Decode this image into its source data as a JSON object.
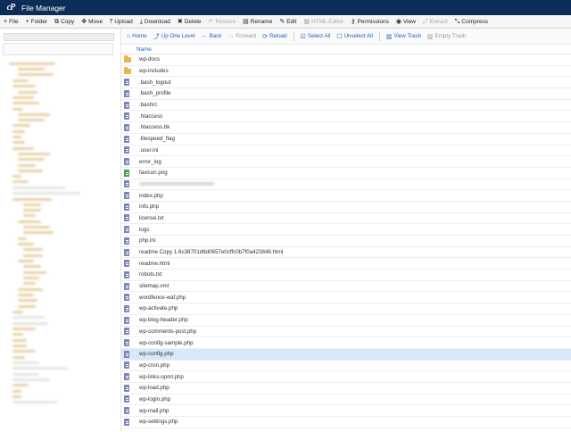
{
  "app": {
    "title": "File Manager",
    "logo_text": "cP"
  },
  "toolbar": [
    {
      "icon": "plus-icon",
      "glyph": "+",
      "label": "File",
      "enabled": true
    },
    {
      "icon": "plus-icon",
      "glyph": "+",
      "label": "Folder",
      "enabled": true
    },
    {
      "icon": "copy-icon",
      "glyph": "⧉",
      "label": "Copy",
      "enabled": true
    },
    {
      "icon": "move-icon",
      "glyph": "✥",
      "label": "Move",
      "enabled": true
    },
    {
      "icon": "upload-icon",
      "glyph": "⤒",
      "label": "Upload",
      "enabled": true
    },
    {
      "icon": "download-icon",
      "glyph": "⤓",
      "label": "Download",
      "enabled": true
    },
    {
      "icon": "close-icon",
      "glyph": "✖",
      "label": "Delete",
      "enabled": true
    },
    {
      "icon": "undo-icon",
      "glyph": "↶",
      "label": "Restore",
      "enabled": false
    },
    {
      "icon": "file-icon",
      "glyph": "▤",
      "label": "Rename",
      "enabled": true
    },
    {
      "icon": "pencil-icon",
      "glyph": "✎",
      "label": "Edit",
      "enabled": true
    },
    {
      "icon": "html-editor-icon",
      "glyph": "▦",
      "label": "HTML Editor",
      "enabled": false
    },
    {
      "icon": "key-icon",
      "glyph": "⚷",
      "label": "Permissions",
      "enabled": true
    },
    {
      "icon": "eye-icon",
      "glyph": "◉",
      "label": "View",
      "enabled": true
    },
    {
      "icon": "extract-icon",
      "glyph": "⤢",
      "label": "Extract",
      "enabled": false
    },
    {
      "icon": "compress-icon",
      "glyph": "⤡",
      "label": "Compress",
      "enabled": true
    }
  ],
  "content_toolbar": [
    {
      "icon": "home-icon",
      "glyph": "⌂",
      "label": "Home",
      "enabled": true
    },
    {
      "icon": "level-up-icon",
      "glyph": "⤴",
      "label": "Up One Level",
      "enabled": true
    },
    {
      "icon": "arrow-left-icon",
      "glyph": "←",
      "label": "Back",
      "enabled": true
    },
    {
      "icon": "arrow-right-icon",
      "glyph": "→",
      "label": "Forward",
      "enabled": false
    },
    {
      "icon": "refresh-icon",
      "glyph": "⟳",
      "label": "Reload",
      "enabled": true
    },
    {
      "icon": "check-square-icon",
      "glyph": "☑",
      "label": "Select All",
      "enabled": true
    },
    {
      "icon": "square-icon",
      "glyph": "☐",
      "label": "Unselect All",
      "enabled": true
    },
    {
      "icon": "trash-icon",
      "glyph": "▥",
      "label": "View Trash",
      "enabled": true
    },
    {
      "icon": "trash-icon",
      "glyph": "▥",
      "label": "Empty Trash",
      "enabled": false
    }
  ],
  "table": {
    "column_name": "Name"
  },
  "files": [
    {
      "name": "wp-docs",
      "type": "folder"
    },
    {
      "name": "wp-includes",
      "type": "folder"
    },
    {
      "name": ".bash_logout",
      "type": "file"
    },
    {
      "name": ".bash_profile",
      "type": "file"
    },
    {
      "name": ".bashrc",
      "type": "file"
    },
    {
      "name": ".htaccess",
      "type": "file"
    },
    {
      "name": ".htaccess.bk",
      "type": "file"
    },
    {
      "name": ".litespeed_flag",
      "type": "file"
    },
    {
      "name": ".user.ini",
      "type": "file"
    },
    {
      "name": "error_log",
      "type": "file"
    },
    {
      "name": "favicon.png",
      "type": "image"
    },
    {
      "name": "",
      "type": "file",
      "redacted": true
    },
    {
      "name": "index.php",
      "type": "file"
    },
    {
      "name": "info.php",
      "type": "file"
    },
    {
      "name": "license.txt",
      "type": "file"
    },
    {
      "name": "logs",
      "type": "file"
    },
    {
      "name": "php.ini",
      "type": "file"
    },
    {
      "name": "readme Copy 1.6c38701d6d0657e0cffc0b7f0a423848.html",
      "type": "file"
    },
    {
      "name": "readme.html",
      "type": "file"
    },
    {
      "name": "robots.txt",
      "type": "file"
    },
    {
      "name": "sitemap.xml",
      "type": "file"
    },
    {
      "name": "wordfence-waf.php",
      "type": "file"
    },
    {
      "name": "wp-activate.php",
      "type": "file"
    },
    {
      "name": "wp-blog-header.php",
      "type": "file"
    },
    {
      "name": "wp-comments-post.php",
      "type": "file"
    },
    {
      "name": "wp-config-sample.php",
      "type": "file"
    },
    {
      "name": "wp-config.php",
      "type": "file",
      "selected": true
    },
    {
      "name": "wp-cron.php",
      "type": "file"
    },
    {
      "name": "wp-links-opml.php",
      "type": "file"
    },
    {
      "name": "wp-load.php",
      "type": "file"
    },
    {
      "name": "wp-login.php",
      "type": "file"
    },
    {
      "name": "wp-mail.php",
      "type": "file"
    },
    {
      "name": "wp-settings.php",
      "type": "file"
    }
  ]
}
